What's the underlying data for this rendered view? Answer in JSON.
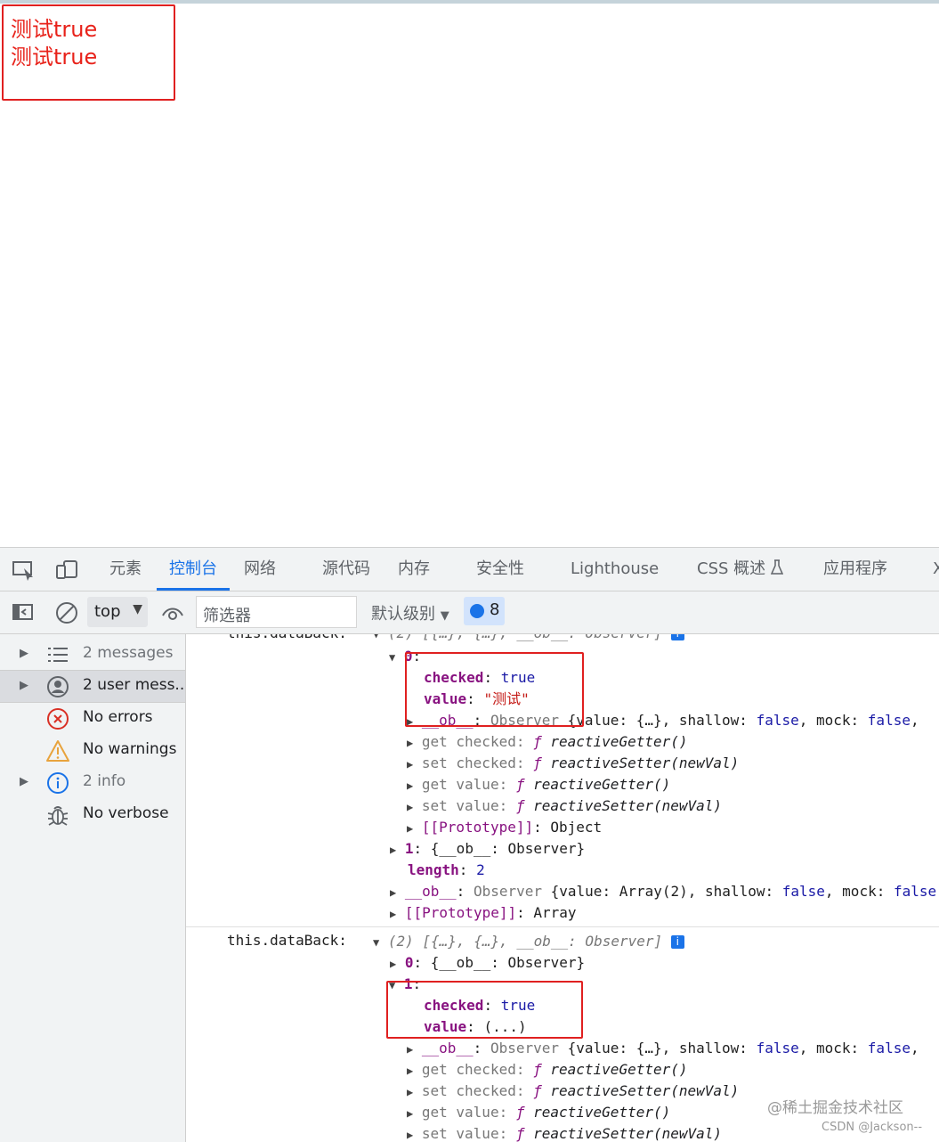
{
  "page": {
    "output_lines": [
      "测试true",
      "测试true"
    ]
  },
  "devtools": {
    "tabs": [
      "元素",
      "控制台",
      "网络",
      "源代码",
      "内存",
      "安全性",
      "Lighthouse",
      "CSS 概述",
      "应用程序",
      "X"
    ],
    "active_tab": "控制台",
    "toolbar": {
      "context": "top",
      "filter_placeholder": "筛选器",
      "levels": "默认级别",
      "issues_count": "8"
    },
    "sidebar": [
      {
        "label": "2 messages",
        "icon": "list-icon",
        "expandable": true
      },
      {
        "label": "2 user mess...",
        "icon": "user-icon",
        "expandable": true,
        "selected": true
      },
      {
        "label": "No errors",
        "icon": "error-icon",
        "expandable": false
      },
      {
        "label": "No warnings",
        "icon": "warning-icon",
        "expandable": false
      },
      {
        "label": "2 info",
        "icon": "info-icon",
        "expandable": true
      },
      {
        "label": "No verbose",
        "icon": "bug-icon",
        "expandable": false
      }
    ],
    "console": {
      "first_label": "this.dataBack:",
      "first_summary": "(2) [{…}, {…}, __ob__: Observer]",
      "second_label": "this.dataBack:",
      "second_summary": "(2) [{…}, {…}, __ob__: Observer]",
      "values": {
        "true": "true",
        "zh_value": "\"测试\"",
        "lazy_value": "(...)",
        "two": "2",
        "false": "false"
      },
      "text": {
        "observer": "Observer",
        "value_obj": "{value: {…}, shallow: ",
        "value_arr": "{value: Array(2), shallow: ",
        "mock": ", mock: ",
        "reactive_getter": "reactiveGetter()",
        "reactive_setter": "reactiveSetter(newVal)",
        "object": "Object",
        "array": "Array",
        "ob_observer": "{__ob__: Observer}",
        "get_checked": "get checked: ",
        "set_checked": "set checked: ",
        "get_value": "get value: ",
        "set_value": "set value: ",
        "f": "ƒ "
      },
      "keys": {
        "checked": "checked",
        "value": "value",
        "ob": "__ob__",
        "length": "length",
        "prototype": "[[Prototype]]",
        "idx0": "0",
        "idx1": "1"
      }
    },
    "watermark": {
      "main": "@稀土掘金技术社区",
      "sub": "CSDN @Jackson--"
    }
  }
}
